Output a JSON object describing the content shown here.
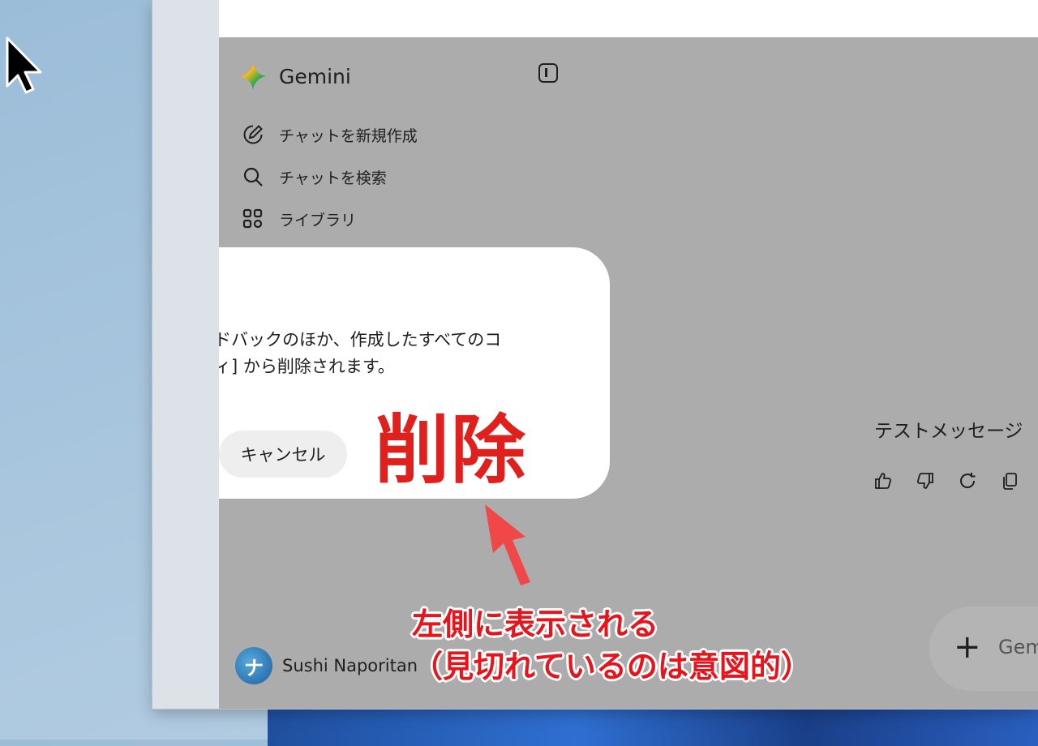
{
  "app": {
    "name": "Gemini"
  },
  "sidebar": {
    "items": [
      {
        "label": "チャットを新規作成",
        "icon": "edit-pen-icon"
      },
      {
        "label": "チャットを検索",
        "icon": "search-icon"
      },
      {
        "label": "ライブラリ",
        "icon": "library-grid-icon"
      }
    ]
  },
  "dialog": {
    "text_line1": "ドバックのほか、作成したすべてのコ",
    "text_line2": "ィ] から削除されます。",
    "cancel_label": "キャンセル"
  },
  "annotation": {
    "big_label": "削除",
    "note_line1": "左側に表示される",
    "note_line2": "（見切れているのは意図的）",
    "color": "#e8141c"
  },
  "chat": {
    "message": "テストメッセージ",
    "input_placeholder": "Gem"
  },
  "user": {
    "name": "Sushi Naporitan",
    "avatar_letter": "ナ"
  },
  "colors": {
    "overlay": "#acacac",
    "accent_red": "#e0201c",
    "dialog_bg": "#ffffff"
  }
}
